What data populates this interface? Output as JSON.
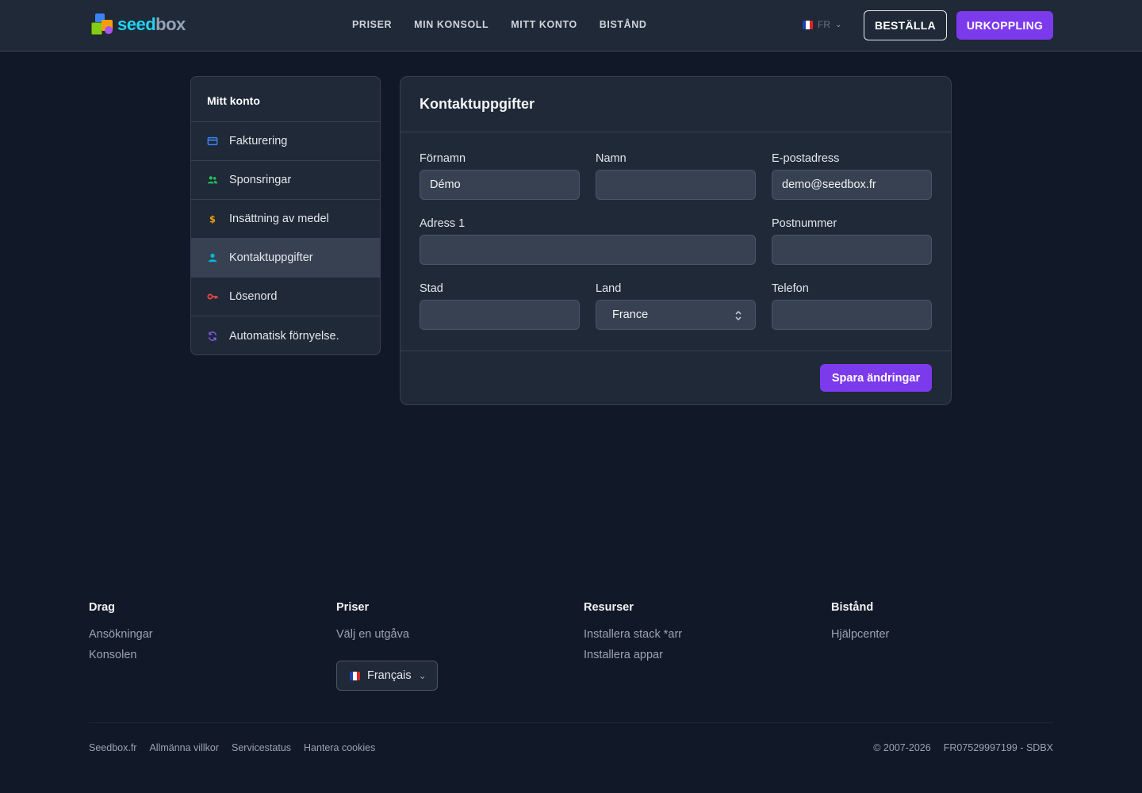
{
  "header": {
    "logo": {
      "part1": "seed",
      "part2": "box"
    },
    "nav": [
      "PRISER",
      "MIN KONSOLL",
      "MITT KONTO",
      "BISTÅND"
    ],
    "lang": "FR",
    "order_label": "BESTÄLLA",
    "logout_label": "URKOPPLING"
  },
  "sidebar": {
    "title": "Mitt konto",
    "items": [
      {
        "label": "Fakturering",
        "icon": "credit-card-icon",
        "color": "#3b82f6"
      },
      {
        "label": "Sponsringar",
        "icon": "users-icon",
        "color": "#22c55e"
      },
      {
        "label": "Insättning av medel",
        "icon": "dollar-icon",
        "color": "#f59e0b"
      },
      {
        "label": "Kontaktuppgifter",
        "icon": "user-icon",
        "color": "#06b6d4",
        "active": true
      },
      {
        "label": "Lösenord",
        "icon": "key-icon",
        "color": "#ef4444"
      },
      {
        "label": "Automatisk förnyelse.",
        "icon": "refresh-icon",
        "color": "#8b5cf6"
      }
    ]
  },
  "form": {
    "title": "Kontaktuppgifter",
    "firstname": {
      "label": "Förnamn",
      "value": "Démo"
    },
    "lastname": {
      "label": "Namn",
      "value": ""
    },
    "email": {
      "label": "E-postadress",
      "value": "demo@seedbox.fr"
    },
    "address": {
      "label": "Adress 1",
      "value": ""
    },
    "postcode": {
      "label": "Postnummer",
      "value": ""
    },
    "city": {
      "label": "Stad",
      "value": ""
    },
    "country": {
      "label": "Land",
      "value": "France"
    },
    "phone": {
      "label": "Telefon",
      "value": ""
    },
    "save_label": "Spara ändringar"
  },
  "footer": {
    "columns": [
      {
        "title": "Drag",
        "links": [
          "Ansökningar",
          "Konsolen"
        ]
      },
      {
        "title": "Priser",
        "links": [
          "Välj en utgåva"
        ]
      },
      {
        "title": "Resurser",
        "links": [
          "Installera stack *arr",
          "Installera appar"
        ]
      },
      {
        "title": "Bistånd",
        "links": [
          "Hjälpcenter"
        ]
      }
    ],
    "language": "Français",
    "bottom_links": [
      "Seedbox.fr",
      "Allmänna villkor",
      "Servicestatus",
      "Hantera cookies"
    ],
    "copyright": "© 2007-2026",
    "company": "FR07529997199 - SDBX"
  },
  "colors": {
    "accent": "#7c3aed",
    "background": "#111827",
    "panel": "#1f2937"
  }
}
